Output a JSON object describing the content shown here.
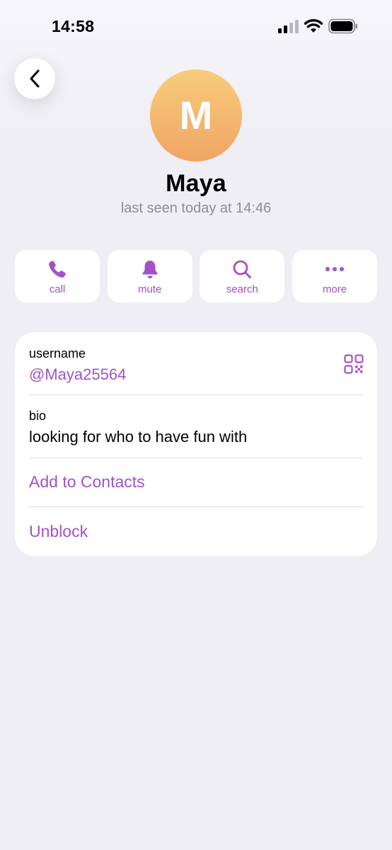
{
  "status_bar": {
    "time": "14:58"
  },
  "profile": {
    "avatar_letter": "M",
    "name": "Maya",
    "last_seen": "last seen today at 14:46",
    "avatar_gradient": [
      "#f8cd7c",
      "#f0a563"
    ]
  },
  "actions": [
    {
      "label": "call",
      "icon": "phone-icon"
    },
    {
      "label": "mute",
      "icon": "bell-icon"
    },
    {
      "label": "search",
      "icon": "search-icon"
    },
    {
      "label": "more",
      "icon": "more-dots-icon"
    }
  ],
  "info": {
    "username_label": "username",
    "username_value": "@Maya25564",
    "bio_label": "bio",
    "bio_value": "looking for who to have fun with",
    "add_contact": "Add to Contacts",
    "unblock": "Unblock"
  },
  "colors": {
    "accent": "#a252c6",
    "background": "#efeef4",
    "secondary_text": "#8e8d92"
  }
}
